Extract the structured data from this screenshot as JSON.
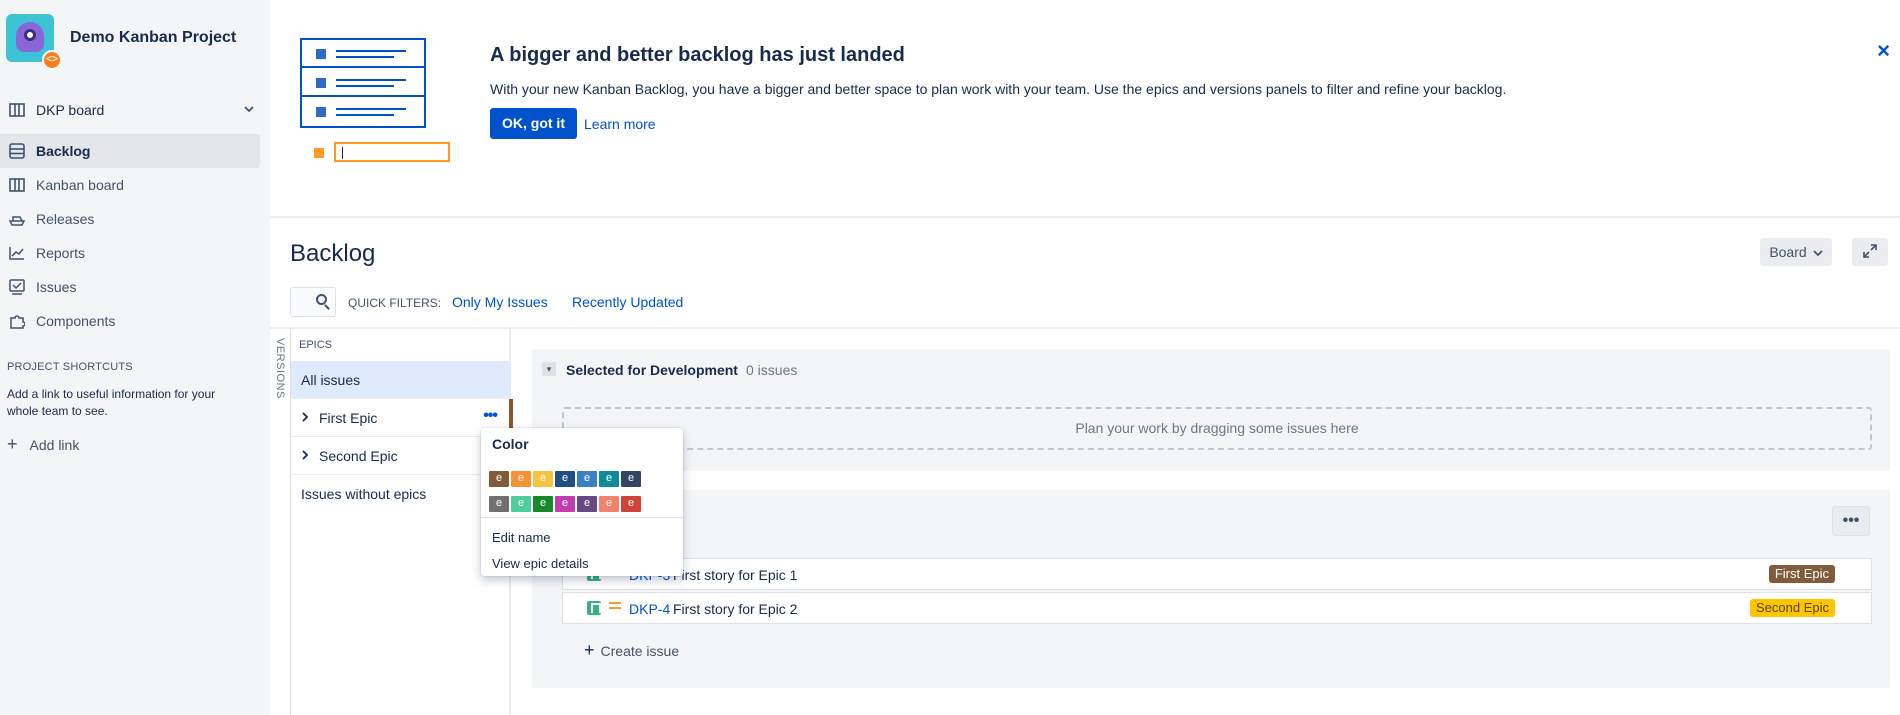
{
  "project": {
    "name": "Demo Kanban Project"
  },
  "sidebar": {
    "board_selector": "DKP board",
    "items": [
      {
        "label": "Backlog",
        "icon": "backlog-icon",
        "active": true
      },
      {
        "label": "Kanban board",
        "icon": "board-icon"
      },
      {
        "label": "Releases",
        "icon": "ship-icon"
      },
      {
        "label": "Reports",
        "icon": "chart-icon"
      },
      {
        "label": "Issues",
        "icon": "issues-icon"
      },
      {
        "label": "Components",
        "icon": "puzzle-icon"
      }
    ],
    "shortcuts_heading": "PROJECT SHORTCUTS",
    "shortcuts_desc": "Add a link to useful information for your whole team to see.",
    "add_link": "Add link"
  },
  "banner": {
    "title": "A bigger and better backlog has just landed",
    "text": "With your new Kanban Backlog, you have a bigger and better space to plan work with your team. Use the epics and versions panels to filter and refine your backlog.",
    "ok_button": "OK, got it",
    "learn_more": "Learn more",
    "close": "×"
  },
  "page": {
    "title": "Backlog",
    "board_button": "Board",
    "quick_filters_label": "QUICK FILTERS:",
    "quick_filters": [
      "Only My Issues",
      "Recently Updated"
    ]
  },
  "epics_panel": {
    "versions_tab": "VERSIONS",
    "heading": "EPICS",
    "all_issues": "All issues",
    "epics": [
      {
        "name": "First Epic",
        "color": "#8b572a"
      },
      {
        "name": "Second Epic",
        "color": "#ffc400"
      }
    ],
    "without_epics": "Issues without epics"
  },
  "color_popup": {
    "title": "Color",
    "swatch_letter": "e",
    "colors_row1": [
      "#815b3a",
      "#f79232",
      "#f6c342",
      "#205081",
      "#3b7fc4",
      "#0e8a98",
      "#344563"
    ],
    "colors_row2": [
      "#707070",
      "#4bce97",
      "#14892c",
      "#c43bb1",
      "#654982",
      "#f2826a",
      "#d04437"
    ],
    "edit_name": "Edit name",
    "view_details": "View epic details"
  },
  "sprint": {
    "title": "Selected for Development",
    "count": "0 issues",
    "drop_hint": "Plan your work by dragging some issues here"
  },
  "backlog": {
    "more": "•••",
    "issues": [
      {
        "key": "DKP-3",
        "summary": "First story for Epic 1",
        "epic": "First Epic",
        "epic_bg": "#815b3a",
        "epic_fg": "#ffffff"
      },
      {
        "key": "DKP-4",
        "summary": "First story for Epic 2",
        "epic": "Second Epic",
        "epic_bg": "#ffc400",
        "epic_fg": "#594300"
      }
    ],
    "create_issue": "Create issue"
  }
}
